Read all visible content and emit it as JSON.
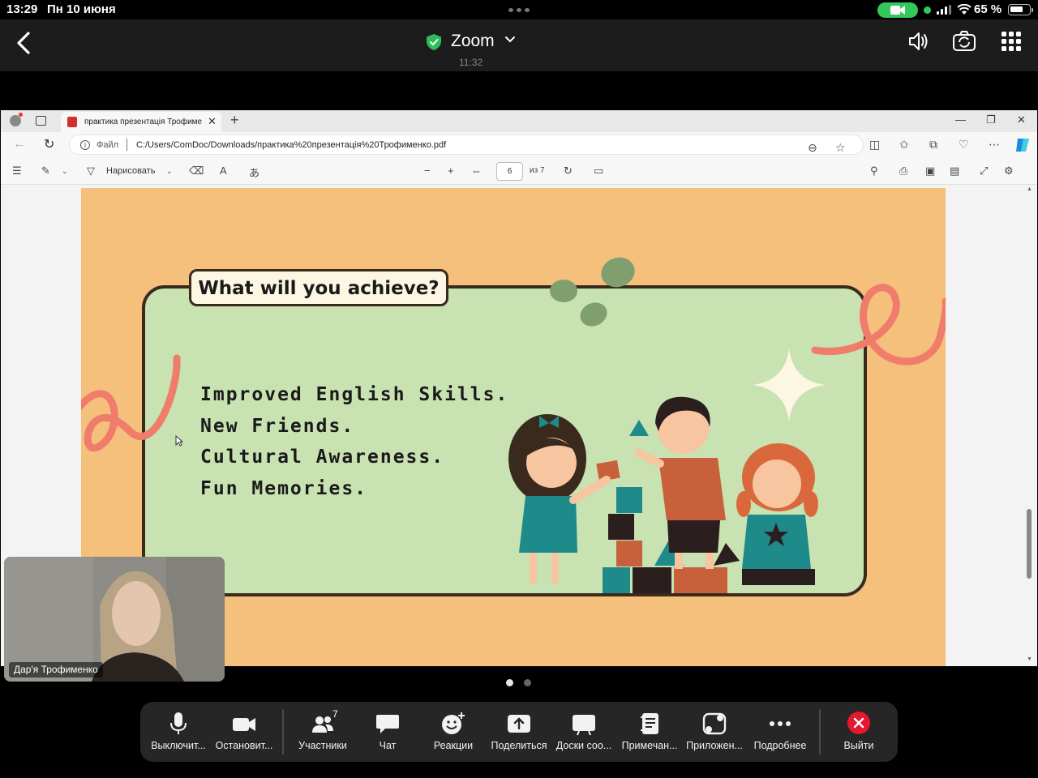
{
  "status_bar": {
    "time": "13:29",
    "date": "Пн 10 июня",
    "battery": "65 %"
  },
  "zoom_header": {
    "title": "Zoom",
    "meeting_time": "11:32"
  },
  "browser": {
    "tab_title": "практика презентація Трофиме",
    "url_label": "Файл",
    "url": "C:/Users/ComDoc/Downloads/практика%20презентація%20Трофименко.pdf"
  },
  "pdf_toolbar": {
    "draw_label": "Нарисовать",
    "current_page": "6",
    "page_total": "из 7"
  },
  "slide": {
    "title": "What will you achieve?",
    "items": [
      "Improved English Skills.",
      "New Friends.",
      "Cultural Awareness.",
      "Fun Memories."
    ]
  },
  "self_view": {
    "name": "Дар'я Трофименко"
  },
  "bottom_bar": {
    "participants_count": "7",
    "items": [
      {
        "label": "Выключит...",
        "icon": "microphone-icon"
      },
      {
        "label": "Остановит...",
        "icon": "video-camera-icon"
      },
      {
        "label": "Участники",
        "icon": "participants-icon"
      },
      {
        "label": "Чат",
        "icon": "chat-icon"
      },
      {
        "label": "Реакции",
        "icon": "reactions-icon"
      },
      {
        "label": "Поделиться",
        "icon": "share-screen-icon"
      },
      {
        "label": "Доски соо...",
        "icon": "whiteboard-icon"
      },
      {
        "label": "Примечан...",
        "icon": "notes-icon"
      },
      {
        "label": "Приложен...",
        "icon": "apps-icon"
      },
      {
        "label": "Подробнее",
        "icon": "more-icon"
      },
      {
        "label": "Выйти",
        "icon": "leave-icon"
      }
    ]
  },
  "colors": {
    "slide_background": "#f4c07b",
    "slide_panel": "#c8e2b2",
    "leave_red": "#e5182d",
    "ios_green": "#34c759"
  }
}
